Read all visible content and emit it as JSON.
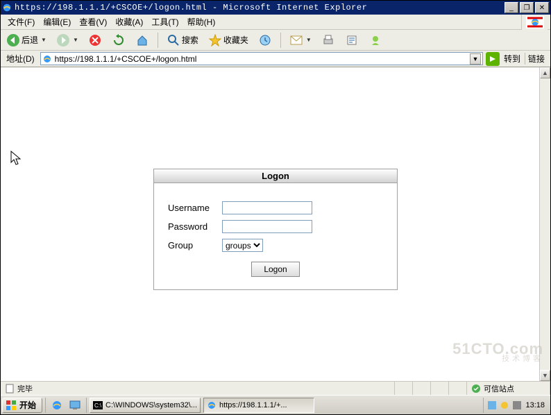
{
  "titlebar": {
    "text": "https://198.1.1.1/+CSCOE+/logon.html - Microsoft Internet Explorer"
  },
  "menu": {
    "file": "文件(F)",
    "edit": "编辑(E)",
    "view": "查看(V)",
    "fav": "收藏(A)",
    "tools": "工具(T)",
    "help": "帮助(H)"
  },
  "toolbar": {
    "back": "后退",
    "search": "搜索",
    "favorites": "收藏夹"
  },
  "addressbar": {
    "label": "地址(D)",
    "url": "https://198.1.1.1/+CSCOE+/logon.html",
    "go": "转到",
    "links": "链接"
  },
  "logon": {
    "title": "Logon",
    "username_label": "Username",
    "password_label": "Password",
    "group_label": "Group",
    "group_selected": "groups",
    "button": "Logon"
  },
  "status": {
    "done": "完毕",
    "zone": "可信站点"
  },
  "taskbar": {
    "start": "开始",
    "task1": "C:\\WINDOWS\\system32\\...",
    "task2": "https://198.1.1.1/+...",
    "clock": "13:18"
  },
  "watermark": {
    "big": "51CTO.com",
    "small": "技术博客"
  }
}
